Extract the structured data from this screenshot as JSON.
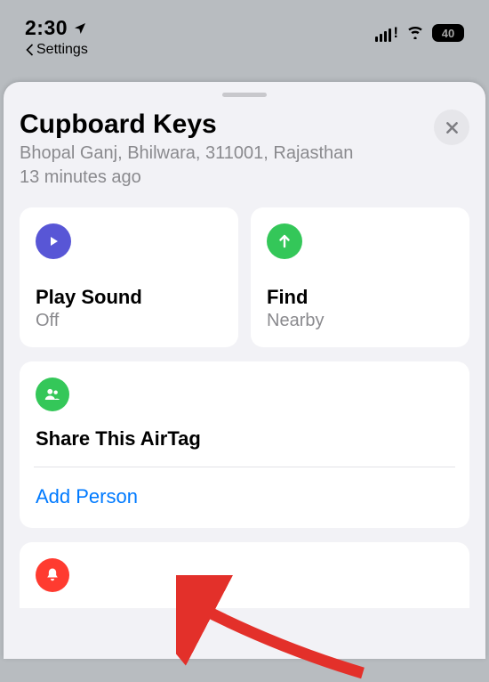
{
  "status": {
    "time": "2:30",
    "back_label": "Settings",
    "battery_level": "40"
  },
  "sheet": {
    "title": "Cupboard Keys",
    "location": "Bhopal Ganj, Bhilwara, 311001, Rajasthan",
    "time_ago": "13 minutes ago"
  },
  "actions": {
    "play_sound": {
      "title": "Play Sound",
      "status": "Off"
    },
    "find": {
      "title": "Find",
      "status": "Nearby"
    }
  },
  "share": {
    "title": "Share This AirTag",
    "add_person": "Add Person"
  }
}
